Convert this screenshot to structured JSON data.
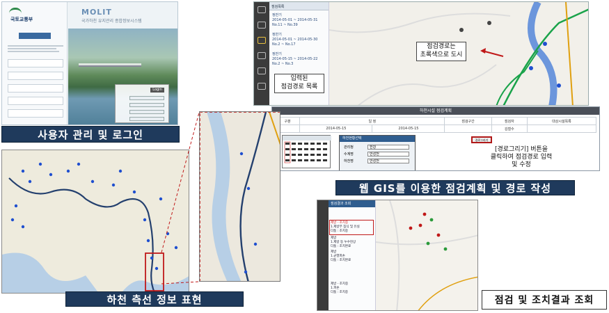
{
  "captions": {
    "login": "사용자 관리 및 로그인",
    "gis": "웹 GIS를 이용한 점검계획 및 경로 작성",
    "river": "하천 측선 정보 표현",
    "results": "점검 및 조치결과 조회"
  },
  "callouts": {
    "route_list": "입력된\n점검경로 목록",
    "route_green": "점검경로는\n초록색으로 도시",
    "draw_button_note": "[경로그리기] 버튼을\n클릭하여 점검경로 입력\n및 수정"
  },
  "login_panel": {
    "org": "국토교통부",
    "brand": "MOLIT",
    "brand_sub": "국가하천 유지관리 종합정보시스템",
    "login_label": "Login"
  },
  "plan_window": {
    "list_header": "점검목록",
    "items": [
      {
        "title": "정반기",
        "date": "2014-05-01 ~ 2014-05-31",
        "range": "No.11 ~ No.39"
      },
      {
        "title": "정반기",
        "date": "2014-05-01 ~ 2014-05-30",
        "range": "No.2 ~ No.17"
      },
      {
        "title": "정반기",
        "date": "2014-05-15 ~ 2014-05-22",
        "range": "No.2 ~ No.3"
      }
    ]
  },
  "plan_form": {
    "title": "하천시설 점검계획",
    "headers": [
      "구분",
      "일 정",
      "점검구간",
      "점검자",
      "대상시설목록"
    ],
    "start_date": "2014-05-15",
    "end_date": "2014-05-15",
    "draw_button": "경로그리기",
    "popup_title": "하천현황선택",
    "popup_fields": [
      "관리청",
      "수계명",
      "하천명"
    ],
    "popup_values": [
      "한강",
      "안성천",
      "안성천"
    ],
    "inspector": "김철수"
  },
  "results_panel": {
    "header": "점검결과 조회",
    "items": [
      {
        "title": "제방 - 조치중",
        "desc": "1.제방부 침식 및 유실",
        "status": "다툼 : 조치중"
      },
      {
        "title": "제방",
        "desc": "1.제방 등 누수현상",
        "status": "다툼 : 조치완료"
      },
      {
        "title": "제방",
        "desc": "1.균열파손",
        "status": "다툼 : 조치완료"
      },
      {
        "title": "제방 - 조치중",
        "desc": "1.파손",
        "status": "다툼 : 조치중"
      }
    ]
  },
  "colors": {
    "caption_bg": "#1f3a5c",
    "route_green": "#1aa34a",
    "river_blue": "#4a7fd8",
    "highlight_red": "#c01818",
    "marker_blue": "#1f4fcf"
  }
}
